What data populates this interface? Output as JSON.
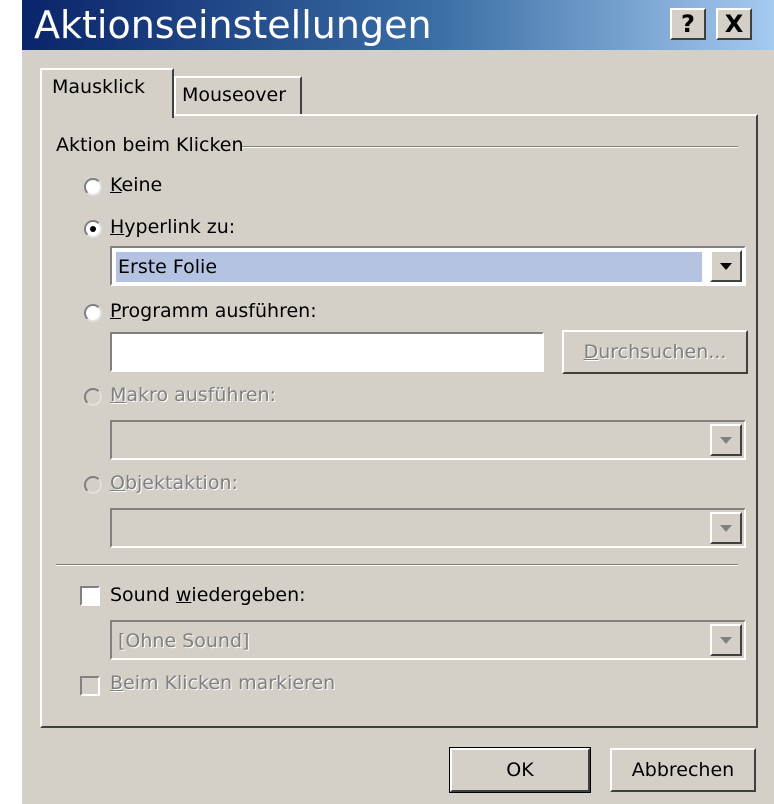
{
  "window": {
    "title": "Aktionseinstellungen",
    "help_label": "?",
    "close_label": "X"
  },
  "tabs": [
    {
      "label": "Mausklick",
      "active": true
    },
    {
      "label": "Mouseover",
      "active": false
    }
  ],
  "section": {
    "title": "Aktion beim Klicken"
  },
  "options": {
    "keine": {
      "label": "Keine",
      "selected": false,
      "enabled": true
    },
    "hyperlink": {
      "label": "Hyperlink zu:",
      "selected": true,
      "enabled": true,
      "value": "Erste Folie"
    },
    "programm": {
      "label": "Programm ausführen:",
      "selected": false,
      "enabled": true,
      "value": "",
      "browse_label": "Durchsuchen..."
    },
    "makro": {
      "label": "Makro ausführen:",
      "selected": false,
      "enabled": false,
      "value": ""
    },
    "objekt": {
      "label": "Objektaktion:",
      "selected": false,
      "enabled": false,
      "value": ""
    }
  },
  "sound": {
    "label": "Sound wiedergeben:",
    "checked": false,
    "value": "[Ohne Sound]"
  },
  "highlight": {
    "label": "Beim Klicken markieren",
    "checked": false,
    "enabled": false
  },
  "buttons": {
    "ok_label": "OK",
    "cancel_label": "Abbrechen"
  },
  "colors": {
    "face": "#d4d0c8",
    "title_start": "#0a246a",
    "title_end": "#a6caf0",
    "selection": "#b5c3e2"
  }
}
